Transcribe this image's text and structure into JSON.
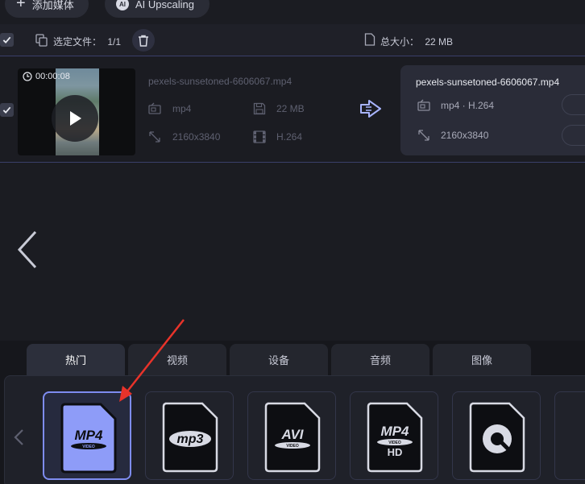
{
  "toolbar": {
    "add_media_label": "添加媒体",
    "ai_badge": "AI",
    "ai_upscaling_label": "AI Upscaling"
  },
  "selection": {
    "selected_label": "选定文件：",
    "selected_count": "1/1",
    "total_label": "总大小：",
    "total_size": "22 MB"
  },
  "source_file": {
    "duration": "00:00:08",
    "name": "pexels-sunsetoned-6606067.mp4",
    "format": "mp4",
    "size": "22 MB",
    "resolution": "2160x3840",
    "codec": "H.264"
  },
  "output_file": {
    "name": "pexels-sunsetoned-6606067.mp4",
    "format_codec": "mp4 · H.264",
    "resolution": "2160x3840"
  },
  "format_tabs": [
    "热门",
    "视频",
    "设备",
    "音频",
    "图像"
  ],
  "active_tab": "热门",
  "formats": [
    {
      "label": "MP4",
      "sub": "VIDEO",
      "selected": true
    },
    {
      "label": "mp3",
      "sub": "",
      "selected": false
    },
    {
      "label": "AVI",
      "sub": "VIDEO",
      "selected": false
    },
    {
      "label": "MP4",
      "sub": "VIDEO",
      "badge": "HD",
      "selected": false
    },
    {
      "label": "",
      "sub": "",
      "icon": "quicktime-icon",
      "selected": false
    }
  ],
  "colors": {
    "accent": "#7e8cf0",
    "selected_fill": "#8e9cf8",
    "annotation_red": "#e8332a"
  }
}
